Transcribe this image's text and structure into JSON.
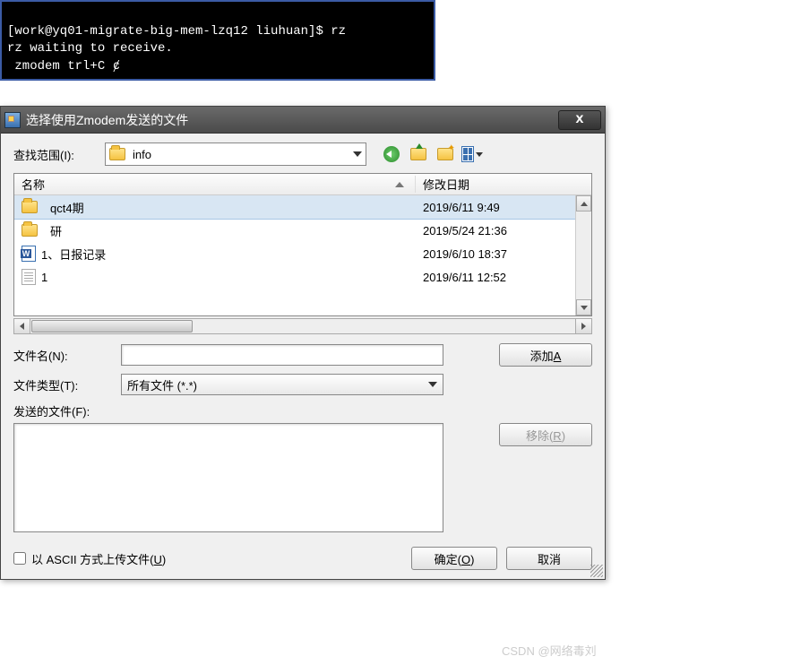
{
  "terminal": {
    "line1": "[work@yq01-migrate-big-mem-lzq12 liuhuan]$ rz",
    "line2": "rz waiting to receive.",
    "line3": " zmodem trl+C ȼ"
  },
  "dialog": {
    "title": "选择使用Zmodem发送的文件",
    "close": "x"
  },
  "lookin": {
    "label": "查找范围(I):",
    "value": "info"
  },
  "columns": {
    "name": "名称",
    "date": "修改日期"
  },
  "rows": [
    {
      "icon": "folder",
      "name": "qct4期",
      "date": "2019/6/11 9:49",
      "selected": true
    },
    {
      "icon": "folder",
      "name": "研",
      "date": "2019/5/24 21:36",
      "selected": false
    },
    {
      "icon": "word",
      "name": "1、日报记录",
      "date": "2019/6/10 18:37",
      "selected": false
    },
    {
      "icon": "text",
      "name": "1",
      "date": "2019/6/11 12:52",
      "selected": false
    }
  ],
  "filename": {
    "label": "文件名(N):",
    "value": ""
  },
  "filetype": {
    "label": "文件类型(T):",
    "value": "所有文件 (*.*)"
  },
  "filesToSend": {
    "label": "发送的文件(F):"
  },
  "buttons": {
    "add_prefix": "添加",
    "add_key": "A",
    "remove_prefix": "移除(",
    "remove_key": "R",
    "remove_suffix": ")",
    "ok_prefix": "确定(",
    "ok_key": "O",
    "ok_suffix": ")",
    "cancel": "取消"
  },
  "ascii": {
    "prefix": "以 ASCII 方式上传文件(",
    "key": "U",
    "suffix": ")",
    "checked": false
  },
  "watermark": "CSDN @网络毒刘"
}
